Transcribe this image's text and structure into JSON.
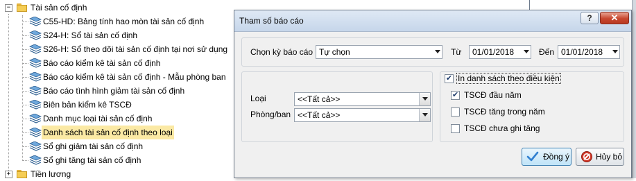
{
  "tree": {
    "root_label": "Tài sản cố định",
    "items": [
      {
        "label": "C55-HD: Bảng tính hao mòn tài sản cố định"
      },
      {
        "label": "S24-H: Sổ tài sản cố định"
      },
      {
        "label": "S26-H: Sổ theo dõi tài sản cố định tại nơi sử dụng"
      },
      {
        "label": "Báo cáo kiểm kê tài sản cố định"
      },
      {
        "label": "Báo cáo kiểm kê tài sản cố định - Mẫu phòng ban"
      },
      {
        "label": "Báo cáo tình hình giảm tài sản cố định"
      },
      {
        "label": "Biên bản kiểm kê TSCĐ"
      },
      {
        "label": "Danh mục loại tài sản cố định"
      },
      {
        "label": "Danh sách tài sản cố định theo loại"
      },
      {
        "label": "Sổ ghi giảm tài sản cố định"
      },
      {
        "label": "Sổ ghi tăng tài sản cố định"
      }
    ],
    "next_root_label": "Tiền lương",
    "expanded_glyph": "−",
    "collapsed_glyph": "+"
  },
  "dialog": {
    "title": "Tham số báo cáo",
    "help_label": "?",
    "close_label": "✕",
    "period": {
      "label": "Chọn kỳ báo cáo",
      "value": "Tự chọn",
      "from_label": "Từ",
      "from_value": "01/01/2018",
      "to_label": "Đến",
      "to_value": "01/01/2018"
    },
    "filters": {
      "type_label": "Loại",
      "type_value": "<<Tất cả>>",
      "dept_label": "Phòng/ban",
      "dept_value": "<<Tất cả>>"
    },
    "options": {
      "print_by_condition": {
        "label": "In danh sách theo điều kiện",
        "checked": true
      },
      "items": [
        {
          "label": "TSCĐ đầu năm",
          "checked": true
        },
        {
          "label": "TSCĐ tăng trong năm",
          "checked": false
        },
        {
          "label": "TSCĐ chưa ghi tăng",
          "checked": false
        }
      ]
    },
    "buttons": {
      "ok_label": "Đồng ý",
      "cancel_label": "Hủy bỏ"
    }
  },
  "colors": {
    "selected_bg": "#fbe9a4",
    "titlebar": "#c6d6ea",
    "close_red": "#c8472f",
    "ok_check": "#2f7fd0",
    "cancel_red": "#d23a2a"
  }
}
